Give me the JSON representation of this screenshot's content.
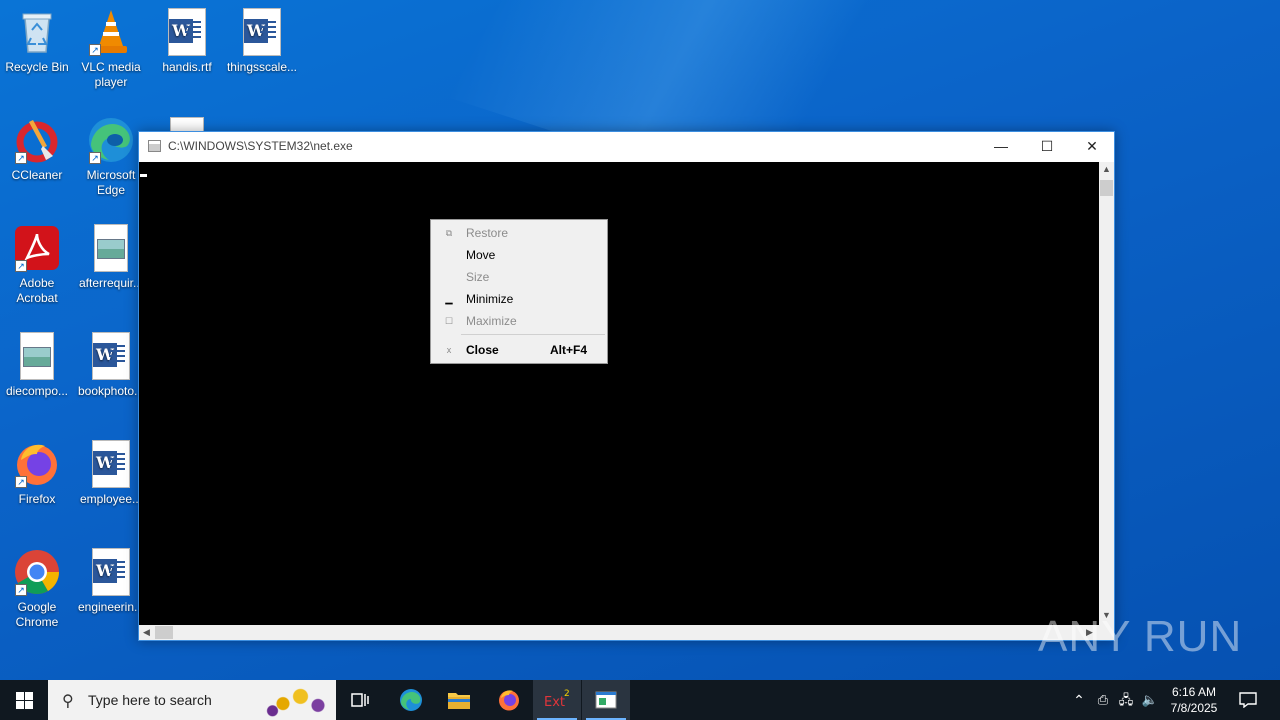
{
  "desktop": {
    "icons": [
      {
        "label": "Recycle Bin",
        "icon": "recycle-bin-icon"
      },
      {
        "label": "VLC media player",
        "icon": "vlc-icon"
      },
      {
        "label": "handis.rtf",
        "icon": "word-document-icon"
      },
      {
        "label": "thingsscale...",
        "icon": "word-document-icon"
      },
      {
        "label": "CCleaner",
        "icon": "ccleaner-icon"
      },
      {
        "label": "Microsoft Edge",
        "icon": "edge-icon"
      },
      {
        "label": "Adobe Acrobat",
        "icon": "acrobat-icon"
      },
      {
        "label": "afterrequir...",
        "icon": "image-file-icon"
      },
      {
        "label": "diecompo...",
        "icon": "image-file-icon"
      },
      {
        "label": "bookphoto...",
        "icon": "word-document-icon"
      },
      {
        "label": "Firefox",
        "icon": "firefox-icon"
      },
      {
        "label": "employee...",
        "icon": "word-document-icon"
      },
      {
        "label": "Google Chrome",
        "icon": "chrome-icon"
      },
      {
        "label": "engineerin...",
        "icon": "word-document-icon"
      }
    ]
  },
  "window": {
    "title": "C:\\WINDOWS\\SYSTEM32\\net.exe",
    "minimize_glyph": "—",
    "maximize_glyph": "☐",
    "close_glyph": "✕"
  },
  "context_menu": {
    "items": [
      {
        "label": "Restore",
        "enabled": false,
        "glyph": "⧉"
      },
      {
        "label": "Move",
        "enabled": true,
        "glyph": ""
      },
      {
        "label": "Size",
        "enabled": false,
        "glyph": ""
      },
      {
        "label": "Minimize",
        "enabled": true,
        "glyph": "▁"
      },
      {
        "label": "Maximize",
        "enabled": false,
        "glyph": "☐"
      },
      {
        "label": "Close",
        "enabled": true,
        "glyph": "x",
        "accelerator": "Alt+F4"
      }
    ]
  },
  "watermark": "ANY RUN",
  "taskbar": {
    "search_placeholder": "Type here to search",
    "clock_time": "6:16 AM",
    "clock_date": "7/8/2025",
    "accent_color": "#6cb4ff"
  }
}
